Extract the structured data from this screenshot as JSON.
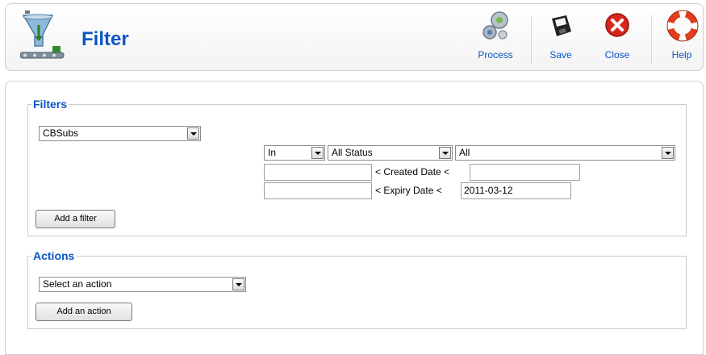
{
  "header": {
    "title": "Filter",
    "icon": "filter-funnel-icon",
    "buttons": [
      {
        "label": "Process",
        "icon": "gears-icon"
      },
      {
        "label": "Save",
        "icon": "floppy-disk-icon"
      },
      {
        "label": "Close",
        "icon": "close-circle-icon"
      },
      {
        "label": "Help",
        "icon": "lifebuoy-icon"
      }
    ]
  },
  "filters": {
    "legend": "Filters",
    "plugin_select": "CBSubs",
    "in_select": "In",
    "status_select": "All Status",
    "plan_select": "All",
    "created_from": "",
    "created_label": "< Created Date <",
    "created_to": "",
    "expiry_from": "",
    "expiry_label": "< Expiry Date <",
    "expiry_to": "2011-03-12",
    "add_button": "Add a filter"
  },
  "actions": {
    "legend": "Actions",
    "action_select": "Select an action",
    "add_button": "Add an action"
  },
  "colors": {
    "accent": "#0b55c4",
    "border": "#cfcfcf"
  }
}
